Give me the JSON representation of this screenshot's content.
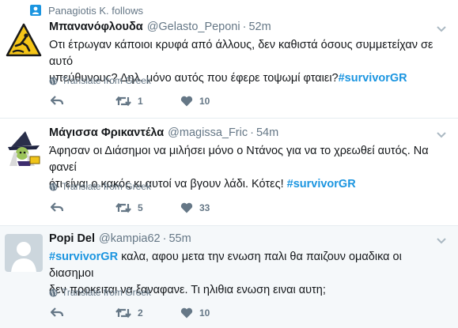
{
  "colors": {
    "link": "#1b95e0",
    "muted": "#657786",
    "text": "#14171a",
    "divider": "#e6ecf0"
  },
  "context": {
    "text": "Panagiotis K. follows",
    "icon": "person-icon"
  },
  "tweets": [
    {
      "name": "Μπανανόφλουδα",
      "handle": "@Gelasto_Peponi",
      "time": "52m",
      "text_line1": "Οτι έτρωγαν κάποιοι κρυφά από άλλους, δεν καθιστά όσους συμμετείχαν σε αυτό",
      "text_line2": "υπεύθυνους? Δηλ. μόνο αυτός που έφερε τοψωμί φταιει?",
      "hashtag": "#survivorGR",
      "translate": "Translate from Greek",
      "retweets": "1",
      "likes": "10"
    },
    {
      "name": "Μάγισσα Φρικαντέλα",
      "handle": "@magissa_Fric",
      "time": "54m",
      "text_line1": "Άφησαν οι Διάσημοι να μιλήσει μόνο ο Ντάνος για να το χρεωθεί αυτός. Να φανεί",
      "text_line2": "ότι είναι ο κακός κι αυτοί να βγουν λάδι. Κότες!",
      "hashtag": "#survivorGR",
      "translate": "Translate from Greek",
      "retweets": "5",
      "likes": "33"
    },
    {
      "name": "Popi Del",
      "handle": "@kampia62",
      "time": "55m",
      "hashtag": "#survivorGR",
      "text_line1": "καλα, αφου μετα την ενωση παλι θα παιζουν ομαδικα οι διασημοι",
      "text_line2": "δεν προκειται να ξαναφανε. Τι ηλιθια ενωση ειναι αυτη;",
      "translate": "Translate from Greek",
      "retweets": "2",
      "likes": "10"
    }
  ]
}
